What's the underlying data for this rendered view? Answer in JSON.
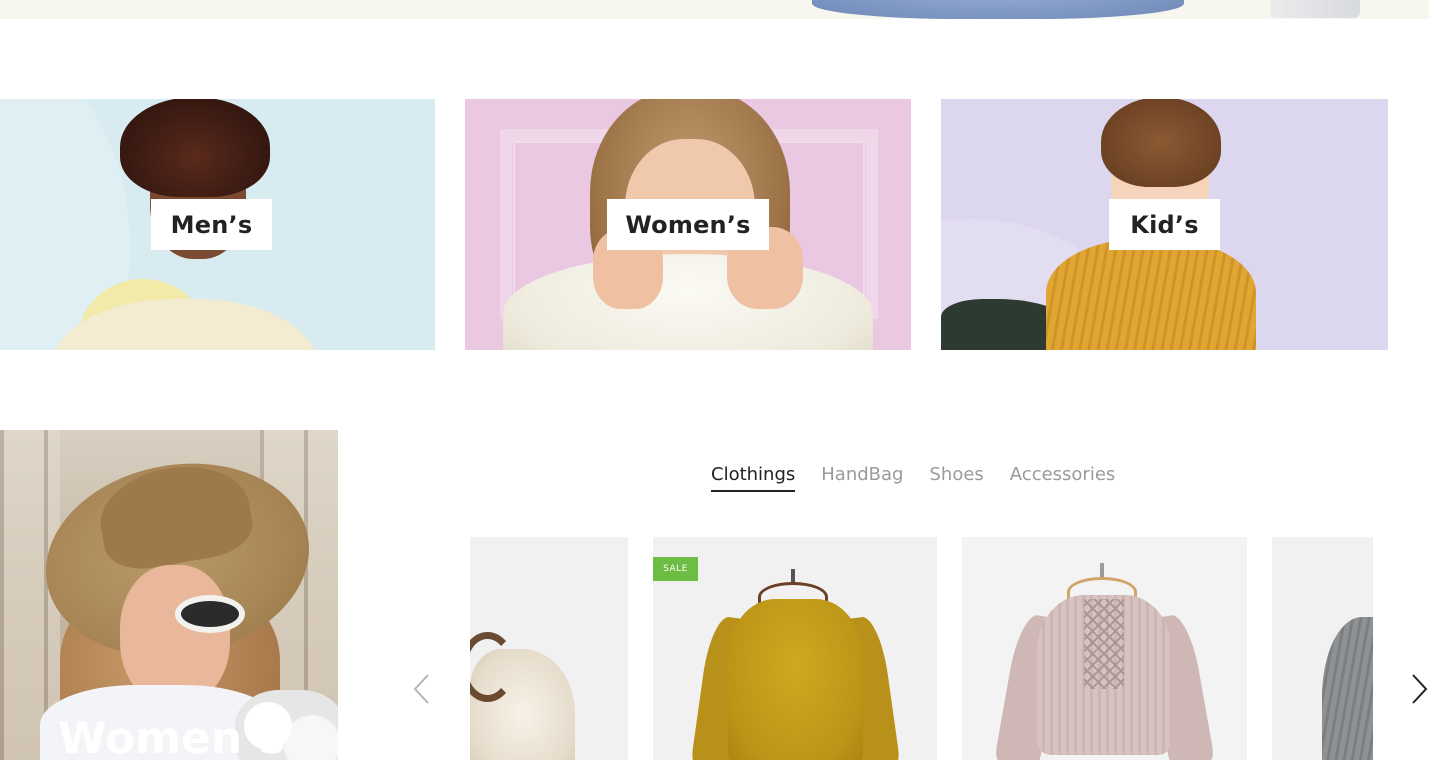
{
  "categories": [
    {
      "key": "men",
      "label": "Men’s"
    },
    {
      "key": "women",
      "label": "Women’s"
    },
    {
      "key": "kids",
      "label": "Kid’s"
    }
  ],
  "promo": {
    "label": "Women’s"
  },
  "tabs": [
    {
      "label": "Clothings",
      "active": true
    },
    {
      "label": "HandBag",
      "active": false
    },
    {
      "label": "Shoes",
      "active": false
    },
    {
      "label": "Accessories",
      "active": false
    }
  ],
  "products": [
    {
      "name": "handbag",
      "badge": ""
    },
    {
      "name": "mustard-sweater",
      "badge": "SALE"
    },
    {
      "name": "pink-lace-sweater",
      "badge": ""
    },
    {
      "name": "grey-sweater",
      "badge": ""
    }
  ],
  "colors": {
    "sale_badge": "#6dbd45",
    "active_tab": "#222222",
    "inactive_tab": "#9a9a9a"
  },
  "icons": {
    "prev": "chevron-left-icon",
    "next": "chevron-right-icon"
  }
}
